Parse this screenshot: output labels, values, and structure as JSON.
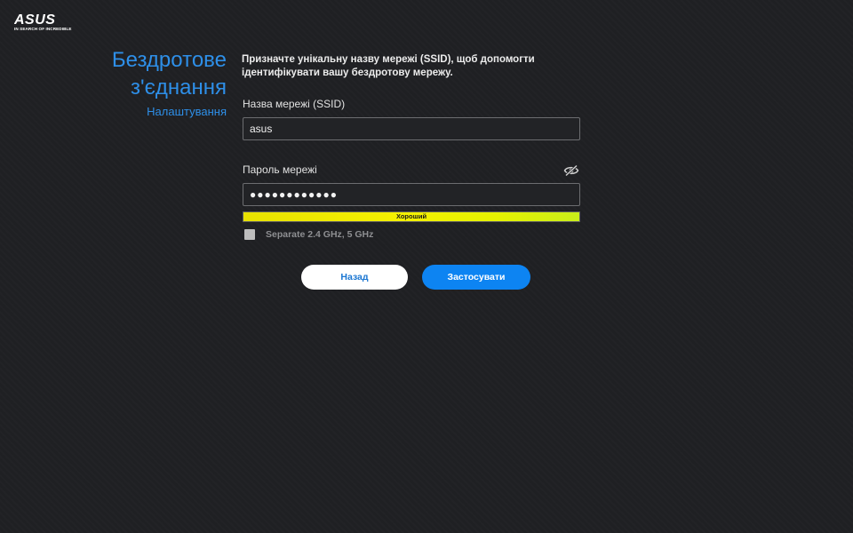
{
  "brand": {
    "logo_text": "ASUS",
    "tagline": "IN SEARCH OF INCREDIBLE"
  },
  "header": {
    "title_line1": "Бездротове",
    "title_line2": "з'єднання",
    "subtitle": "Налаштування"
  },
  "form": {
    "instruction": "Призначте унікальну назву мережі (SSID), щоб допомогти ідентифікувати вашу бездротову мережу.",
    "ssid_label": "Назва мережі (SSID)",
    "ssid_value": "asus",
    "password_label": "Пароль мережі",
    "password_value": "●●●●●●●●●●●●",
    "password_strength": {
      "label": "Хороший",
      "level": 1.0
    },
    "separate_bands": {
      "label": "Separate 2.4 GHz, 5 GHz",
      "checked": false
    }
  },
  "buttons": {
    "back": "Назад",
    "apply": "Застосувати"
  },
  "icons": {
    "password_toggle": "eye-slash-icon"
  },
  "colors": {
    "background": "#1f2023",
    "accent_blue": "#2e8fe8",
    "apply_button": "#0d84f2",
    "strength_good": "#f4f000"
  }
}
